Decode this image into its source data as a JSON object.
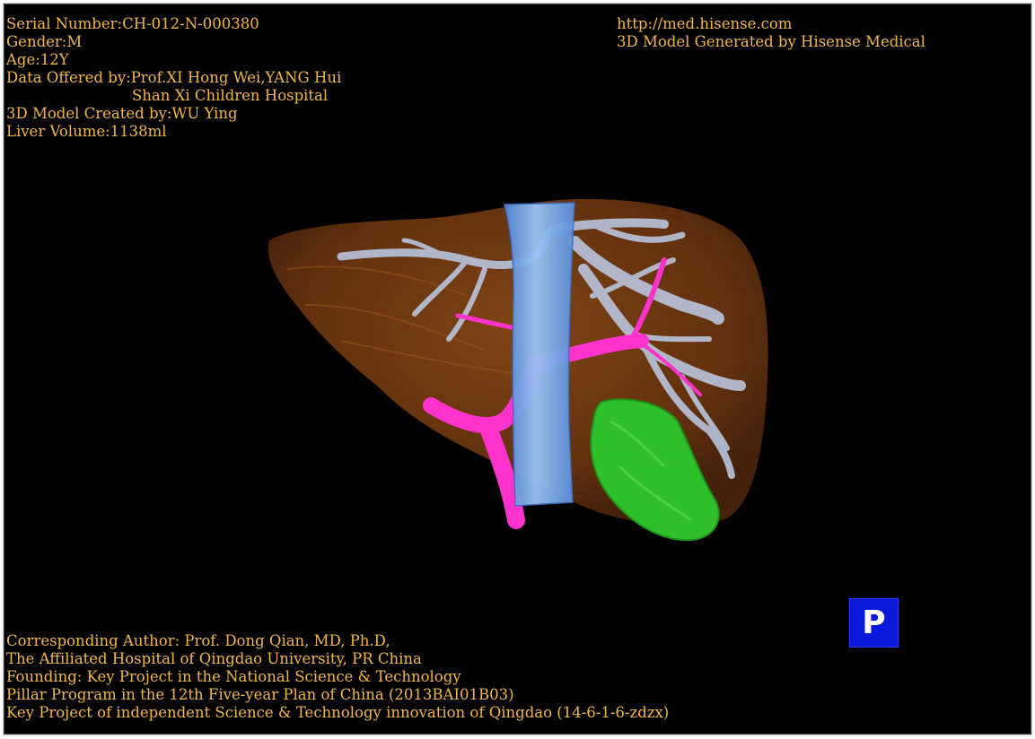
{
  "info_top_left": {
    "serial": "Serial Number:CH-012-N-000380",
    "gender": "Gender:M",
    "age": "Age:12Y",
    "data_offered": "Data Offered by:Prof.XI Hong Wei,YANG Hui",
    "hospital": "Shan Xi Children Hospital",
    "created_by": "3D Model Created by:WU Ying",
    "liver_volume": "Liver Volume:1138ml"
  },
  "info_top_right": {
    "url": "http://med.hisense.com",
    "generated_by": "3D Model Generated by Hisense Medical"
  },
  "info_bottom_left": {
    "author": "Corresponding Author: Prof. Dong Qian, MD, Ph.D,",
    "affiliation": "The Affiliated Hospital of Qingdao University, PR China",
    "founding": "Founding: Key Project in the National Science & Technology",
    "pillar": "Pillar Program in the 12th Five-year Plan of China (2013BAI01B03)",
    "key_project": "Key Project of independent Science & Technology innovation of Qingdao (14-6-1-6-zdzx)"
  },
  "p_button": {
    "label": "P"
  },
  "colors": {
    "text": "#f0b64a",
    "liver": "#7a3f12",
    "vena_cava": "#7fb0f0",
    "hepatic_veins": "#b9c4dc",
    "portal_vein": "#ff33cc",
    "tumor": "#2fbf2a",
    "p_button": "#0a18d8"
  }
}
